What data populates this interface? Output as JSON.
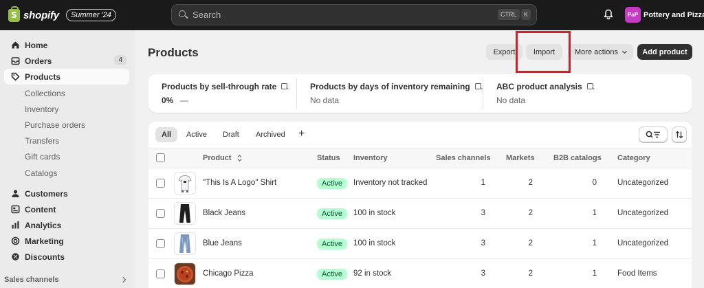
{
  "topbar": {
    "brand": "shopify",
    "edition": "Summer '24",
    "search_placeholder": "Search",
    "shortcut_ctrl": "CTRL",
    "shortcut_key": "K",
    "store_initials": "PaP",
    "store_name": "Pottery and Pizza"
  },
  "sidebar": {
    "items": [
      {
        "label": "Home",
        "icon": "home-icon"
      },
      {
        "label": "Orders",
        "icon": "orders-icon",
        "badge": "4"
      },
      {
        "label": "Products",
        "icon": "tag-icon",
        "active": true
      },
      {
        "label": "Collections"
      },
      {
        "label": "Inventory"
      },
      {
        "label": "Purchase orders"
      },
      {
        "label": "Transfers"
      },
      {
        "label": "Gift cards"
      },
      {
        "label": "Catalogs"
      },
      {
        "label": "Customers",
        "icon": "person-icon"
      },
      {
        "label": "Content",
        "icon": "content-icon"
      },
      {
        "label": "Analytics",
        "icon": "bar-chart-icon"
      },
      {
        "label": "Marketing",
        "icon": "target-icon"
      },
      {
        "label": "Discounts",
        "icon": "discount-icon"
      }
    ],
    "footer_label": "Sales channels"
  },
  "page": {
    "title": "Products",
    "export_label": "Export",
    "import_label": "Import",
    "more_actions_label": "More actions",
    "add_product_label": "Add product"
  },
  "metrics": [
    {
      "title": "Products by sell-through rate",
      "value": "0%",
      "suffix": "—"
    },
    {
      "title": "Products by days of inventory remaining",
      "value": "No data"
    },
    {
      "title": "ABC product analysis",
      "value": "No data"
    }
  ],
  "tabs": [
    "All",
    "Active",
    "Draft",
    "Archived"
  ],
  "table": {
    "headers": {
      "product": "Product",
      "status": "Status",
      "inventory": "Inventory",
      "sales_channels": "Sales channels",
      "markets": "Markets",
      "b2b": "B2B catalogs",
      "category": "Category"
    },
    "rows": [
      {
        "name": "\"This Is A Logo\" Shirt",
        "status": "Active",
        "inventory": "Inventory not tracked",
        "sales_channels": "1",
        "markets": "2",
        "b2b": "0",
        "category": "Uncategorized"
      },
      {
        "name": "Black Jeans",
        "status": "Active",
        "inventory": "100 in stock",
        "sales_channels": "3",
        "markets": "2",
        "b2b": "1",
        "category": "Uncategorized"
      },
      {
        "name": "Blue Jeans",
        "status": "Active",
        "inventory": "100 in stock",
        "sales_channels": "3",
        "markets": "2",
        "b2b": "1",
        "category": "Uncategorized"
      },
      {
        "name": "Chicago Pizza",
        "status": "Active",
        "inventory": "92 in stock",
        "sales_channels": "3",
        "markets": "2",
        "b2b": "1",
        "category": "Food Items"
      }
    ]
  },
  "colors": {
    "topbar": "#1a1a1a",
    "brand_green": "#95bf47",
    "status_badge": "#b4fed2",
    "highlight": "#d0202a"
  }
}
